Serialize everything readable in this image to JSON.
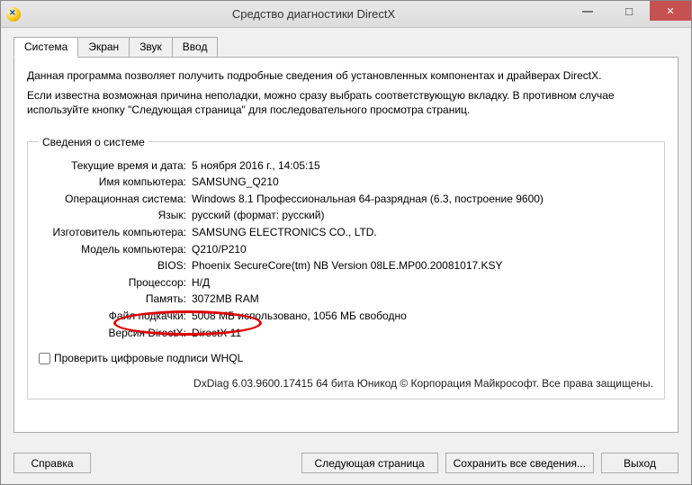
{
  "window": {
    "title": "Средство диагностики DirectX"
  },
  "tabs": {
    "system": "Система",
    "screen": "Экран",
    "sound": "Звук",
    "input": "Ввод"
  },
  "intro": {
    "p1": "Данная программа позволяет получить подробные сведения об установленных компонентах и драйверах DirectX.",
    "p2": "Если известна возможная причина неполадки, можно сразу выбрать соответствующую вкладку. В противном случае используйте кнопку \"Следующая страница\" для последовательного просмотра страниц."
  },
  "sysinfo": {
    "legend": "Сведения о системе",
    "rows": [
      {
        "label": "Текущие время и дата:",
        "value": "5 ноября 2016 г., 14:05:15"
      },
      {
        "label": "Имя компьютера:",
        "value": "SAMSUNG_Q210"
      },
      {
        "label": "Операционная система:",
        "value": "Windows 8.1 Профессиональная 64-разрядная (6.3, построение 9600)"
      },
      {
        "label": "Язык:",
        "value": "русский (формат: русский)"
      },
      {
        "label": "Изготовитель компьютера:",
        "value": "SAMSUNG ELECTRONICS CO., LTD."
      },
      {
        "label": "Модель компьютера:",
        "value": "Q210/P210"
      },
      {
        "label": "BIOS:",
        "value": "Phoenix SecureCore(tm) NB Version 08LE.MP00.20081017.KSY"
      },
      {
        "label": "Процессор:",
        "value": "Н/Д"
      },
      {
        "label": "Память:",
        "value": "3072MB RAM"
      },
      {
        "label": "Файл подкачки:",
        "value": "5008 МБ использовано, 1056 МБ свободно"
      },
      {
        "label": "Версия DirectX:",
        "value": "DirectX 11"
      }
    ]
  },
  "whql": {
    "label": "Проверить цифровые подписи WHQL"
  },
  "footer": "DxDiag 6.03.9600.17415 64 бита Юникод © Корпорация Майкрософт. Все права защищены.",
  "buttons": {
    "help": "Справка",
    "next": "Следующая страница",
    "save": "Сохранить все сведения...",
    "exit": "Выход"
  }
}
